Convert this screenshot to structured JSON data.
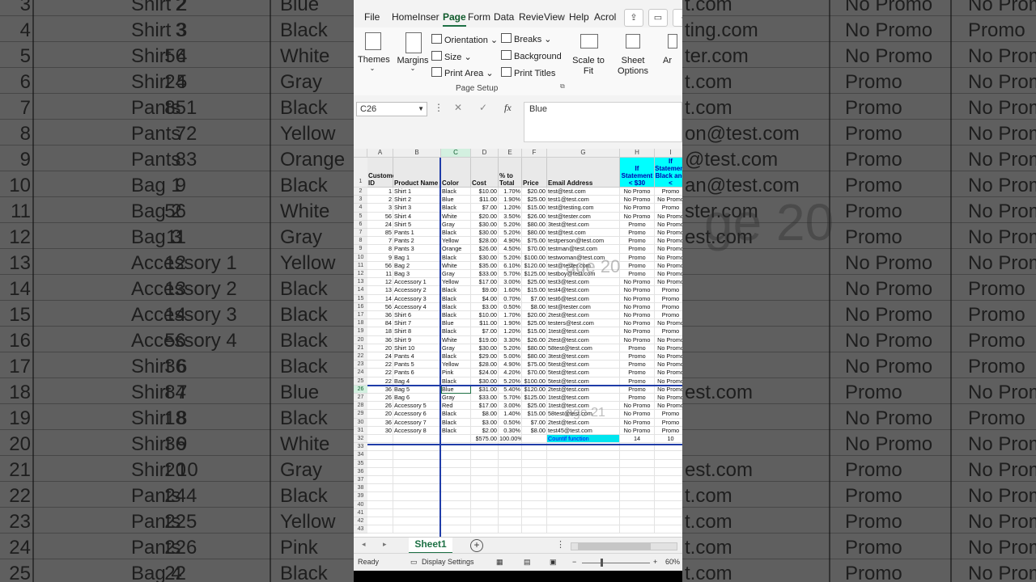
{
  "background": {
    "rows": [
      {
        "rn": "3",
        "id": "2",
        "name": "Shirt 2",
        "color": "Blue",
        "email": "t.com",
        "p1": "No Promo",
        "p2": "No Promo"
      },
      {
        "rn": "4",
        "id": "3",
        "name": "Shirt 3",
        "color": "Black",
        "email": "ting.com",
        "p1": "No Promo",
        "p2": "Promo"
      },
      {
        "rn": "5",
        "id": "56",
        "name": "Shirt 4",
        "color": "White",
        "email": "ter.com",
        "p1": "No Promo",
        "p2": "No Promo"
      },
      {
        "rn": "6",
        "id": "24",
        "name": "Shirt 5",
        "color": "Gray",
        "email": "t.com",
        "p1": "Promo",
        "p2": "No Promo"
      },
      {
        "rn": "7",
        "id": "85",
        "name": "Pants 1",
        "color": "Black",
        "email": "t.com",
        "p1": "Promo",
        "p2": "No Promo"
      },
      {
        "rn": "8",
        "id": "7",
        "name": "Pants 2",
        "color": "Yellow",
        "email": "on@test.com",
        "p1": "Promo",
        "p2": "No Promo"
      },
      {
        "rn": "9",
        "id": "8",
        "name": "Pants 3",
        "color": "Orange",
        "email": "@test.com",
        "p1": "Promo",
        "p2": "No Promo"
      },
      {
        "rn": "10",
        "id": "9",
        "name": "Bag 1",
        "color": "Black",
        "email": "an@test.com",
        "p1": "Promo",
        "p2": "No Promo"
      },
      {
        "rn": "11",
        "id": "56",
        "name": "Bag 2",
        "color": "White",
        "email": "ster.com",
        "p1": "Promo",
        "p2": "No Promo"
      },
      {
        "rn": "12",
        "id": "11",
        "name": "Bag 3",
        "color": "Gray",
        "email": "est.com",
        "p1": "Promo",
        "p2": "No Promo"
      },
      {
        "rn": "13",
        "id": "12",
        "name": "Accessory 1",
        "color": "Yellow",
        "email": "",
        "p1": "No Promo",
        "p2": "No Promo"
      },
      {
        "rn": "14",
        "id": "13",
        "name": "Accessory 2",
        "color": "Black",
        "email": "",
        "p1": "No Promo",
        "p2": "Promo"
      },
      {
        "rn": "15",
        "id": "14",
        "name": "Accessory 3",
        "color": "Black",
        "email": "",
        "p1": "No Promo",
        "p2": "Promo"
      },
      {
        "rn": "16",
        "id": "56",
        "name": "Accessory 4",
        "color": "Black",
        "email": "",
        "p1": "No Promo",
        "p2": "Promo"
      },
      {
        "rn": "17",
        "id": "36",
        "name": "Shirt 6",
        "color": "Black",
        "email": "",
        "p1": "No Promo",
        "p2": "Promo"
      },
      {
        "rn": "18",
        "id": "84",
        "name": "Shirt 7",
        "color": "Blue",
        "email": "est.com",
        "p1": "Promo",
        "p2": "No Promo"
      },
      {
        "rn": "19",
        "id": "18",
        "name": "Shirt 8",
        "color": "Black",
        "email": "",
        "p1": "No Promo",
        "p2": "Promo"
      },
      {
        "rn": "20",
        "id": "36",
        "name": "Shirt 9",
        "color": "White",
        "email": "",
        "p1": "No Promo",
        "p2": "No Promo"
      },
      {
        "rn": "21",
        "id": "20",
        "name": "Shirt 10",
        "color": "Gray",
        "email": "est.com",
        "p1": "Promo",
        "p2": "No Promo"
      },
      {
        "rn": "22",
        "id": "24",
        "name": "Pants 4",
        "color": "Black",
        "email": "t.com",
        "p1": "Promo",
        "p2": "No Promo"
      },
      {
        "rn": "23",
        "id": "22",
        "name": "Pants 5",
        "color": "Yellow",
        "email": "t.com",
        "p1": "Promo",
        "p2": "No Promo"
      },
      {
        "rn": "24",
        "id": "22",
        "name": "Pants 6",
        "color": "Pink",
        "email": "t.com",
        "p1": "Promo",
        "p2": "No Promo"
      },
      {
        "rn": "25",
        "id": "22",
        "name": "Bag 4",
        "color": "Black",
        "email": "t.com",
        "p1": "Promo",
        "p2": "No Promo"
      }
    ],
    "watermark": "ge 20"
  },
  "menu": {
    "items": [
      "File",
      "Home",
      "Inser",
      "Page",
      "Form",
      "Data",
      "Revie",
      "View",
      "Help",
      "Acrol"
    ],
    "active": "Page"
  },
  "ribbon": {
    "themes": "Themes",
    "margins": "Margins",
    "orientation": "Orientation",
    "size": "Size",
    "print_area": "Print Area",
    "breaks": "Breaks",
    "background": "Background",
    "print_titles": "Print Titles",
    "scale_to_fit": "Scale to Fit",
    "sheet_options": "Sheet Options",
    "arrange": "Ar",
    "group_label": "Page Setup"
  },
  "formula_bar": {
    "name_box": "C26",
    "fx": "fx",
    "value": "Blue"
  },
  "sheet": {
    "col_headers": [
      "A",
      "B",
      "C",
      "D",
      "E",
      "F",
      "G",
      "H",
      "I"
    ],
    "selected_col": "C",
    "selected_row": "26",
    "headers": [
      "Customer ID",
      "Product Name",
      "Color",
      "Cost",
      "% to Total",
      "Price",
      "Email Address",
      "If Statement < $30",
      "If Statement Black and <"
    ],
    "rows": [
      [
        "1",
        "Shirt 1",
        "Black",
        "$10.00",
        "1.70%",
        "$20.00",
        "test@test.com",
        "No Promo",
        "Promo"
      ],
      [
        "2",
        "Shirt 2",
        "Blue",
        "$11.00",
        "1.90%",
        "$25.00",
        "test1@test.com",
        "No Promo",
        "No Promo"
      ],
      [
        "3",
        "Shirt 3",
        "Black",
        "$7.00",
        "1.20%",
        "$15.00",
        "test@testing.com",
        "No Promo",
        "Promo"
      ],
      [
        "56",
        "Shirt 4",
        "White",
        "$20.00",
        "3.50%",
        "$26.00",
        "test@tester.com",
        "No Promo",
        "No Promo"
      ],
      [
        "24",
        "Shirt 5",
        "Gray",
        "$30.00",
        "5.20%",
        "$80.00",
        "3test@test.com",
        "Promo",
        "No Promo"
      ],
      [
        "85",
        "Pants 1",
        "Black",
        "$30.00",
        "5.20%",
        "$80.00",
        "test@test.com",
        "Promo",
        "No Promo"
      ],
      [
        "7",
        "Pants 2",
        "Yellow",
        "$28.00",
        "4.90%",
        "$75.00",
        "testperson@test.com",
        "Promo",
        "No Promo"
      ],
      [
        "8",
        "Pants 3",
        "Orange",
        "$26.00",
        "4.50%",
        "$70.00",
        "testman@test.com",
        "Promo",
        "No Promo"
      ],
      [
        "9",
        "Bag 1",
        "Black",
        "$30.00",
        "5.20%",
        "$100.00",
        "testwoman@test.com",
        "Promo",
        "No Promo"
      ],
      [
        "56",
        "Bag 2",
        "White",
        "$35.00",
        "6.10%",
        "$120.00",
        "test@tester.com",
        "Promo",
        "No Promo"
      ],
      [
        "11",
        "Bag 3",
        "Gray",
        "$33.00",
        "5.70%",
        "$125.00",
        "testboy@test.com",
        "Promo",
        "No Promo"
      ],
      [
        "12",
        "Accessory 1",
        "Yellow",
        "$17.00",
        "3.00%",
        "$25.00",
        "test3@test.com",
        "No Promo",
        "No Promo"
      ],
      [
        "13",
        "Accessory 2",
        "Black",
        "$9.00",
        "1.60%",
        "$15.00",
        "test4@test.com",
        "No Promo",
        "Promo"
      ],
      [
        "14",
        "Accessory 3",
        "Black",
        "$4.00",
        "0.70%",
        "$7.00",
        "test6@test.com",
        "No Promo",
        "Promo"
      ],
      [
        "56",
        "Accessory 4",
        "Black",
        "$3.00",
        "0.50%",
        "$8.00",
        "test@tester.com",
        "No Promo",
        "Promo"
      ],
      [
        "36",
        "Shirt 6",
        "Black",
        "$10.00",
        "1.70%",
        "$20.00",
        "2test@test.com",
        "No Promo",
        "Promo"
      ],
      [
        "84",
        "Shirt 7",
        "Blue",
        "$11.00",
        "1.90%",
        "$25.00",
        "testers@test.com",
        "No Promo",
        "No Promo"
      ],
      [
        "18",
        "Shirt 8",
        "Black",
        "$7.00",
        "1.20%",
        "$15.00",
        "1test@test.com",
        "No Promo",
        "Promo"
      ],
      [
        "36",
        "Shirt 9",
        "White",
        "$19.00",
        "3.30%",
        "$26.00",
        "2test@test.com",
        "No Promo",
        "No Promo"
      ],
      [
        "20",
        "Shirt 10",
        "Gray",
        "$30.00",
        "5.20%",
        "$80.00",
        "58test@test.com",
        "Promo",
        "No Promo"
      ],
      [
        "24",
        "Pants 4",
        "Black",
        "$29.00",
        "5.00%",
        "$80.00",
        "3test@test.com",
        "Promo",
        "No Promo"
      ],
      [
        "22",
        "Pants 5",
        "Yellow",
        "$28.00",
        "4.90%",
        "$75.00",
        "5test@test.com",
        "Promo",
        "No Promo"
      ],
      [
        "22",
        "Pants 6",
        "Pink",
        "$24.00",
        "4.20%",
        "$70.00",
        "5test@test.com",
        "Promo",
        "No Promo"
      ],
      [
        "22",
        "Bag 4",
        "Black",
        "$30.00",
        "5.20%",
        "$100.00",
        "5test@test.com",
        "Promo",
        "No Promo"
      ],
      [
        "36",
        "Bag 5",
        "Blue",
        "$31.00",
        "5.40%",
        "$120.00",
        "2test@test.com",
        "Promo",
        "No Promo"
      ],
      [
        "26",
        "Bag 6",
        "Gray",
        "$33.00",
        "5.70%",
        "$125.00",
        "1test@test.com",
        "Promo",
        "No Promo"
      ],
      [
        "26",
        "Accessory 5",
        "Red",
        "$17.00",
        "3.00%",
        "$25.00",
        "1test@test.com",
        "No Promo",
        "No Promo"
      ],
      [
        "20",
        "Accessory 6",
        "Black",
        "$8.00",
        "1.40%",
        "$15.00",
        "58test@test.com",
        "No Promo",
        "Promo"
      ],
      [
        "36",
        "Accessory 7",
        "Black",
        "$3.00",
        "0.50%",
        "$7.00",
        "2test@test.com",
        "No Promo",
        "Promo"
      ],
      [
        "30",
        "Accessory 8",
        "Black",
        "$2.00",
        "0.30%",
        "$8.00",
        "test45@test.com",
        "No Promo",
        "Promo"
      ]
    ],
    "total_row": {
      "cost": "$575.00",
      "pct": "100.00%",
      "label": "Countif function",
      "h": "14",
      "i": "10"
    },
    "empty_rows": [
      "33",
      "34",
      "35",
      "36",
      "37",
      "38",
      "39",
      "40",
      "41",
      "42",
      "43"
    ],
    "watermarks": [
      "age 20",
      "age 21"
    ]
  },
  "tabs": {
    "sheet1": "Sheet1",
    "add": "+"
  },
  "status": {
    "ready": "Ready",
    "display_settings": "Display Settings",
    "zoom": "60%"
  }
}
